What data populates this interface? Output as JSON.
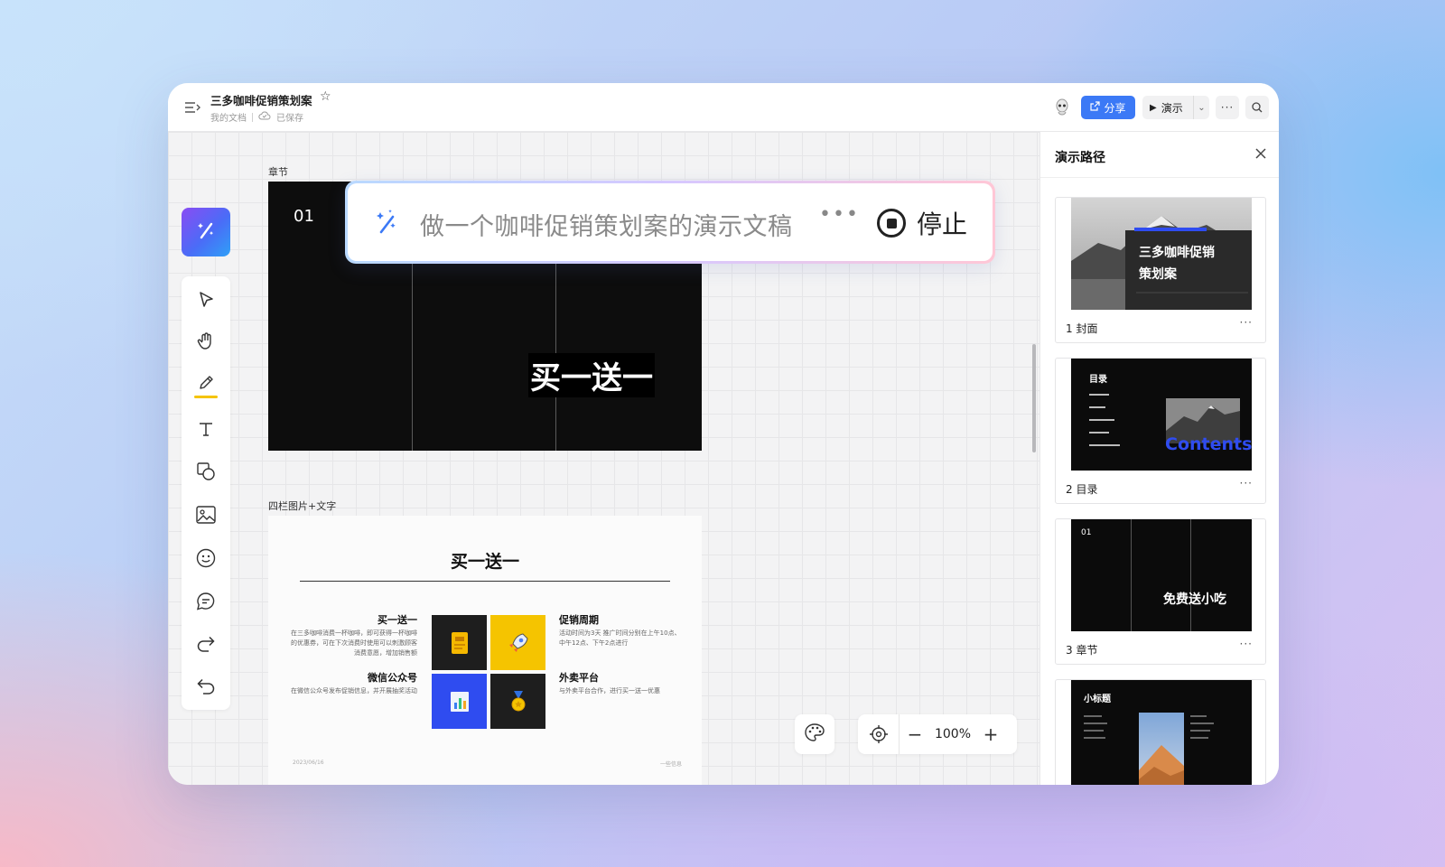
{
  "header": {
    "title": "三多咖啡促销策划案",
    "breadcrumb": "我的文档",
    "save_status": "已保存",
    "share_label": "分享",
    "present_label": "演示"
  },
  "ai_prompt": {
    "text": "做一个咖啡促销策划案的演示文稿",
    "stop_label": "停止"
  },
  "canvas": {
    "frame1_label": "章节",
    "frame1": {
      "number": "01",
      "headline": "买一送一"
    },
    "frame2_label": "四栏图片+文字",
    "frame2": {
      "title": "买一送一",
      "blocks": [
        {
          "heading": "买一送一",
          "body": "在三多咖啡消费一杯咖啡，即可获得一杯咖啡的优惠券，可在下次消费时使用可以刺激顾客消费意愿，增加销售额"
        },
        {
          "heading": "促销周期",
          "body": "活动时间为3天 推广时间分别在上午10点、中午12点、下午2点进行"
        },
        {
          "heading": "微信公众号",
          "body": "在微信公众号发布促销信息，并开展抽奖活动"
        },
        {
          "heading": "外卖平台",
          "body": "与外卖平台合作，进行买一送一优惠"
        }
      ],
      "footer_left": "2023/06/16",
      "footer_right": "一些信息"
    },
    "zoom": "100%"
  },
  "panel": {
    "title": "演示路径",
    "slides": [
      {
        "caption": "1  封面",
        "thumb_title_1": "三多咖啡促销",
        "thumb_title_2": "策划案"
      },
      {
        "caption": "2  目录",
        "thumb_title_1": "目录",
        "thumb_word": "Contents."
      },
      {
        "caption": "3  章节",
        "thumb_num": "01",
        "thumb_title_1": "免费送小吃"
      },
      {
        "caption": "",
        "thumb_title_1": "小标题"
      }
    ]
  },
  "colors": {
    "accent": "#3b79f6",
    "pen_highlight": "#f5c400",
    "slide_dark": "#0d0d0d"
  }
}
